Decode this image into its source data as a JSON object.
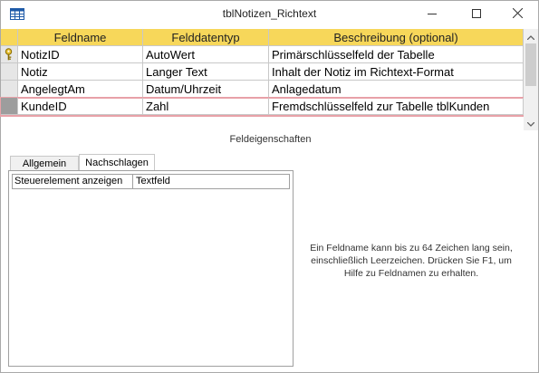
{
  "window": {
    "title": "tblNotizen_Richtext",
    "icons": {
      "app": "table-icon",
      "minimize": "minimize-icon",
      "maximize": "maximize-icon",
      "close": "close-icon"
    }
  },
  "grid": {
    "headers": [
      "Feldname",
      "Felddatentyp",
      "Beschreibung (optional)"
    ],
    "rows": [
      {
        "field": "NotizID",
        "type": "AutoWert",
        "description": "Primärschlüsselfeld der Tabelle",
        "primary_key": true
      },
      {
        "field": "Notiz",
        "type": "Langer Text",
        "description": "Inhalt der Notiz im Richtext-Format"
      },
      {
        "field": "AngelegtAm",
        "type": "Datum/Uhrzeit",
        "description": "Anlagedatum"
      },
      {
        "field": "KundeID",
        "type": "Zahl",
        "description": "Fremdschlüsselfeld zur Tabelle tblKunden",
        "selected": true
      }
    ],
    "colors": {
      "header": "#f7d75a",
      "selection_border": "#e8a1a8"
    }
  },
  "properties": {
    "section_label": "Feldeigenschaften",
    "tabs": [
      "Allgemein",
      "Nachschlagen"
    ],
    "active_tab": "Nachschlagen",
    "rows": [
      {
        "name": "Steuerelement anzeigen",
        "value": "Textfeld"
      }
    ],
    "help_text": "Ein Feldname kann bis zu 64 Zeichen lang sein, einschließlich Leerzeichen. Drücken Sie F1, um Hilfe zu Feldnamen zu erhalten."
  }
}
